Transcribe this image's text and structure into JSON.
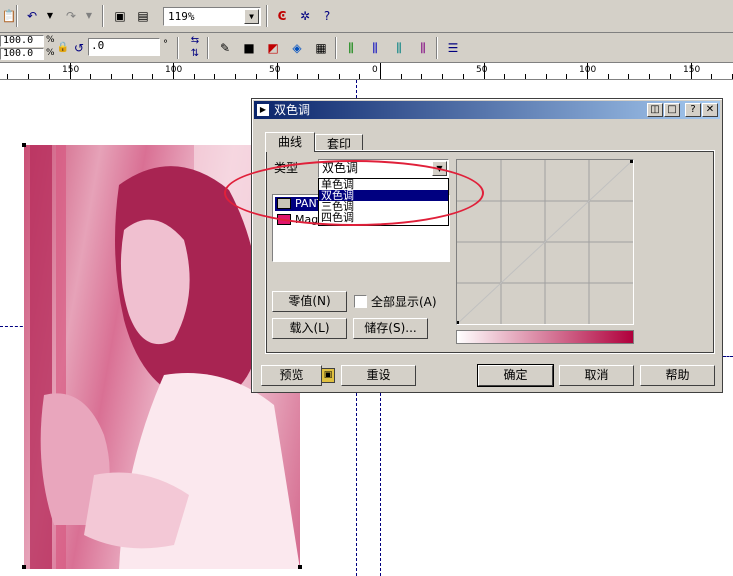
{
  "toolbar": {
    "zoom_value": "119%",
    "pos_x_value": "100.0",
    "pos_y_value": "100.0",
    "unit_pct": "%",
    "rotate_value": ".0",
    "degree_symbol": "°"
  },
  "ruler": {
    "labels": [
      "150",
      "100",
      "50",
      "0",
      "50",
      "100",
      "150"
    ]
  },
  "dialog": {
    "title": "双色调",
    "tabs": [
      "曲线",
      "套印"
    ],
    "type_label": "类型",
    "type_value": "双色调",
    "type_options": [
      "单色调",
      "双色调",
      "三色调",
      "四色调"
    ],
    "selected_option_index": 1,
    "inks": [
      {
        "name": "PANTONE",
        "color": "#c8c4b8"
      },
      {
        "name": "Magenta",
        "color": "#e0156c"
      }
    ],
    "null_button": "零值(N)",
    "show_all_label": "全部显示(A)",
    "load_button": "载入(L)",
    "save_button": "储存(S)...",
    "preview_button": "预览",
    "reset_button": "重设",
    "ok_button": "确定",
    "cancel_button": "取消",
    "help_button": "帮助",
    "gradient_end_color": "#b0003c"
  }
}
